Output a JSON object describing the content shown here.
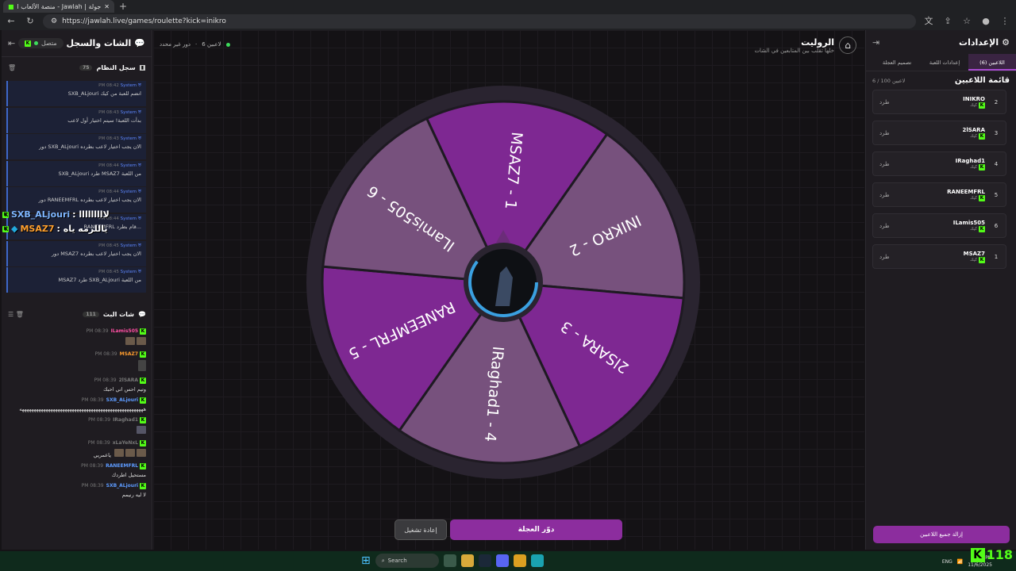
{
  "browser": {
    "tab_title": "جولة | Jawlah - منصة الألعاب التفا...",
    "url": "https://jawlah.live/games/roulette?kick=inikro"
  },
  "left_panel": {
    "title": "الشات والسجل",
    "status": "متصل",
    "system_log": {
      "title": "سجل النظام",
      "count": "75",
      "entries": [
        {
          "sender": "System",
          "time": "PM 08:42",
          "text": "SXB_ALjouri انضم للعبة من كيك"
        },
        {
          "sender": "System",
          "time": "PM 08:43",
          "text": "بدأت اللعبة! سيتم اختيار أول لاعب"
        },
        {
          "sender": "System",
          "time": "PM 08:43",
          "text": "دور SXB_ALjouri الان يجب اختيار لاعب بطرده"
        },
        {
          "sender": "System",
          "time": "PM 08:44",
          "text": "SXB_ALjouri طرد MSAZ7 من اللعبة"
        },
        {
          "sender": "System",
          "time": "PM 08:44",
          "text": "دور RANEEMFRL الان يجب اختيار لاعب بطرده"
        },
        {
          "sender": "System",
          "time": "PM 08:44",
          "text": "RANEEMFRL قام بطرد..."
        },
        {
          "sender": "System",
          "time": "PM 08:45",
          "text": "دور MSAZ7 الان يجب اختيار لاعب بطرده"
        },
        {
          "sender": "System",
          "time": "PM 08:45",
          "text": "MSAZ7 طرد SXB_ALjouri من اللعبة"
        }
      ]
    },
    "stream_chat": {
      "title": "شات البث",
      "count": "111",
      "messages": [
        {
          "user": "ILamis505",
          "time": "PM 08:39",
          "color": "#ff4fa3",
          "text": ""
        },
        {
          "user": "MSAZ7",
          "time": "PM 08:39",
          "color": "#ff9d2e",
          "text": ""
        },
        {
          "user": "2lSARA",
          "time": "PM 08:39",
          "color": "#dddddd",
          "text": "وتيم احس اني احبك"
        },
        {
          "user": "SXB_ALjouri",
          "time": "PM 08:39",
          "color": "#5d9bff",
          "text": "ههههههههههههههههههههههههههههههههههههههههههههههههههههه"
        },
        {
          "user": "IRaghad1",
          "time": "PM 08:39",
          "color": "#dddddd",
          "text": ""
        },
        {
          "user": "xLaYeNxL",
          "time": "PM 08:39",
          "color": "#dddddd",
          "text": "ياعمريي"
        },
        {
          "user": "RANEEMFRL",
          "time": "PM 08:39",
          "color": "#5d9bff",
          "text": "مستحيل اطردك"
        },
        {
          "user": "SXB_ALjouri",
          "time": "PM 08:39",
          "color": "#5d9bff",
          "text": "لا ليه رنيمم"
        }
      ]
    },
    "overlay": {
      "line1_user": "SXB_ALjouri",
      "line1_text": ": لااااااااا",
      "line2_user": "MSAZ7",
      "line2_text": ": ياللزمه ياه"
    }
  },
  "center": {
    "title": "الروليت",
    "subtitle": "خلها تقلب بين المتابعين في الشات",
    "player_info": "6 لاعبين",
    "round_info": "دور غير محدد",
    "wheel_segments": [
      {
        "label": "MSAZ7 - 1",
        "color": "#7e2892"
      },
      {
        "label": "INIKRO - 2",
        "color": "#77517d"
      },
      {
        "label": "2lSARA - 3",
        "color": "#7e2892"
      },
      {
        "label": "IRaghad1 - 4",
        "color": "#77517d"
      },
      {
        "label": "RANEEMFRL - 5",
        "color": "#7e2892"
      },
      {
        "label": "ILamis505 - 6",
        "color": "#77517d"
      }
    ],
    "spin_button": "دوّر العجلة",
    "reset_button": "إعادة تشغيل"
  },
  "right_panel": {
    "title": "الإعدادات",
    "tabs": [
      "اللاعبين (6)",
      "إعدادات اللعبة",
      "تصميم العجلة"
    ],
    "players_title": "قائمة اللاعبين",
    "players_count": "6 / 100 لاعبين",
    "kick_label": "طرد",
    "source_label": "كيك",
    "players": [
      {
        "num": "2",
        "name": "INIKRO"
      },
      {
        "num": "3",
        "name": "2lSARA"
      },
      {
        "num": "4",
        "name": "IRaghad1"
      },
      {
        "num": "5",
        "name": "RANEEMFRL"
      },
      {
        "num": "6",
        "name": "ILamis505"
      },
      {
        "num": "1",
        "name": "MSAZ7"
      }
    ],
    "remove_all_button": "إزالة جميع اللاعبين"
  },
  "taskbar": {
    "search_placeholder": "Search",
    "lang": "ENG",
    "time": "8:46 PM",
    "date": "11/6/2025",
    "viewer_count": "118"
  }
}
